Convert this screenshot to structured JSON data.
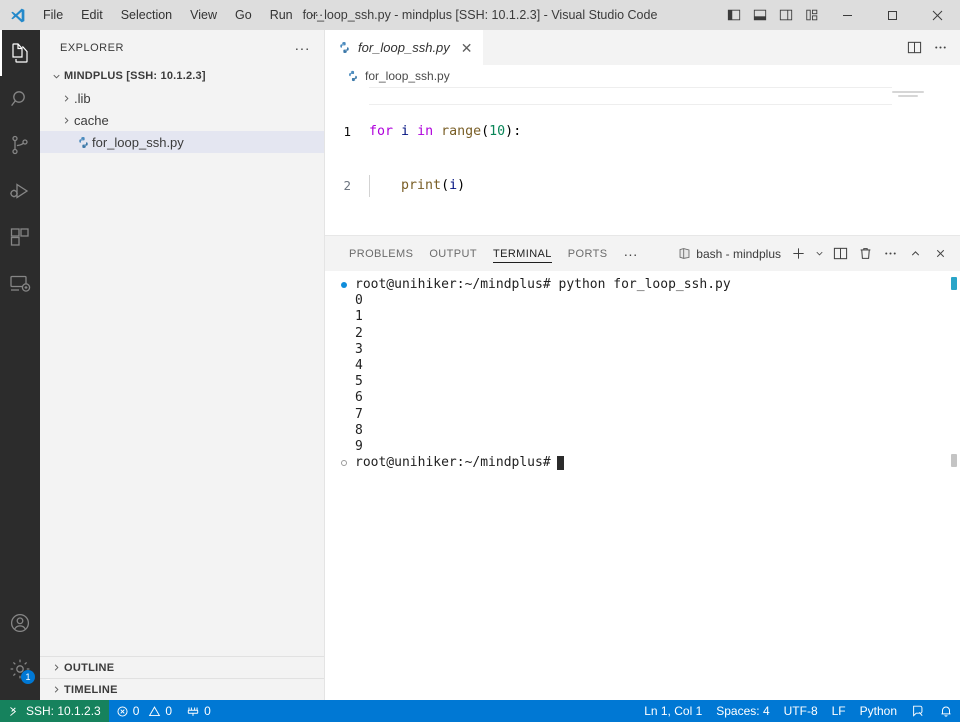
{
  "titlebar": {
    "menus": [
      "File",
      "Edit",
      "Selection",
      "View",
      "Go",
      "Run",
      "···"
    ],
    "window_title": "for_loop_ssh.py - mindplus [SSH: 10.1.2.3] - Visual Studio Code",
    "layout_buttons": [
      "toggle-primary-sidebar",
      "toggle-panel",
      "toggle-secondary-sidebar",
      "customize-layout"
    ],
    "window_controls": {
      "minimize": "─",
      "maximize": "□",
      "close": "✕"
    }
  },
  "activitybar": {
    "items": [
      {
        "name": "explorer",
        "active": true
      },
      {
        "name": "search",
        "active": false
      },
      {
        "name": "source-control",
        "active": false
      },
      {
        "name": "run-and-debug",
        "active": false
      },
      {
        "name": "extensions",
        "active": false
      },
      {
        "name": "remote-explorer",
        "active": false
      }
    ],
    "bottom": [
      {
        "name": "accounts",
        "badge": ""
      },
      {
        "name": "manage-settings",
        "badge": "1"
      }
    ]
  },
  "sidebar": {
    "title": "EXPLORER",
    "more_actions": "···",
    "root": {
      "label": "MINDPLUS [SSH: 10.1.2.3]",
      "expanded": true
    },
    "items": [
      {
        "label": ".lib",
        "type": "folder",
        "expanded": false,
        "selected": false
      },
      {
        "label": "cache",
        "type": "folder",
        "expanded": false,
        "selected": false
      },
      {
        "label": "for_loop_ssh.py",
        "type": "python-file",
        "selected": true
      }
    ],
    "sections": [
      {
        "label": "OUTLINE",
        "expanded": false
      },
      {
        "label": "TIMELINE",
        "expanded": false
      }
    ]
  },
  "editor": {
    "tabs": [
      {
        "label": "for_loop_ssh.py",
        "icon": "python-file-icon",
        "active": true,
        "dirty": false,
        "close": "✕"
      }
    ],
    "tab_actions": [
      "split-editor",
      "more-actions"
    ],
    "breadcrumb": [
      "for_loop_ssh.py"
    ],
    "lines": [
      {
        "number": "1",
        "tokens": [
          {
            "t": "for",
            "c": "k"
          },
          {
            "t": " ",
            "c": "op"
          },
          {
            "t": "i",
            "c": "var"
          },
          {
            "t": " ",
            "c": "op"
          },
          {
            "t": "in",
            "c": "k"
          },
          {
            "t": " ",
            "c": "op"
          },
          {
            "t": "range",
            "c": "fn"
          },
          {
            "t": "(",
            "c": "op"
          },
          {
            "t": "10",
            "c": "num"
          },
          {
            "t": ")",
            "c": "op"
          },
          {
            "t": ":",
            "c": "op"
          }
        ]
      },
      {
        "number": "2",
        "indent": true,
        "tokens": [
          {
            "t": "    ",
            "c": "op"
          },
          {
            "t": "print",
            "c": "fn"
          },
          {
            "t": "(",
            "c": "op"
          },
          {
            "t": "i",
            "c": "var"
          },
          {
            "t": ")",
            "c": "op"
          }
        ]
      }
    ]
  },
  "panel": {
    "tabs": [
      {
        "label": "PROBLEMS",
        "active": false
      },
      {
        "label": "OUTPUT",
        "active": false
      },
      {
        "label": "TERMINAL",
        "active": true
      },
      {
        "label": "PORTS",
        "active": false
      }
    ],
    "more": "···",
    "terminal_name": "bash - mindplus",
    "actions": [
      "new-terminal",
      "terminal-dropdown",
      "split-terminal",
      "kill-terminal",
      "views-and-more",
      "maximize-panel",
      "close-panel"
    ],
    "terminal_lines": [
      {
        "mark": "filled",
        "text": "root@unihiker:~/mindplus# python for_loop_ssh.py"
      },
      {
        "mark": "none",
        "text": "0"
      },
      {
        "mark": "none",
        "text": "1"
      },
      {
        "mark": "none",
        "text": "2"
      },
      {
        "mark": "none",
        "text": "3"
      },
      {
        "mark": "none",
        "text": "4"
      },
      {
        "mark": "none",
        "text": "5"
      },
      {
        "mark": "none",
        "text": "6"
      },
      {
        "mark": "none",
        "text": "7"
      },
      {
        "mark": "none",
        "text": "8"
      },
      {
        "mark": "none",
        "text": "9"
      },
      {
        "mark": "hollow",
        "text": "root@unihiker:~/mindplus#",
        "cursor": true
      }
    ]
  },
  "statusbar": {
    "remote": "SSH: 10.1.2.3",
    "errors": "0",
    "warnings": "0",
    "ports": "0",
    "cursor_position": "Ln 1, Col 1",
    "indentation": "Spaces: 4",
    "encoding": "UTF-8",
    "eol": "LF",
    "language": "Python",
    "feedback": "smiley-icon",
    "notifications": "bell-icon"
  },
  "colors": {
    "accent": "#0078d4",
    "remote_green": "#16825d",
    "titlebar_bg": "#dddddd",
    "sidebar_bg": "#f3f3f3",
    "editor_bg": "#ffffff",
    "activitybar_bg": "#2c2c2c",
    "keyword": "#af00db",
    "function": "#795e26",
    "number": "#098658",
    "variable": "#001080"
  }
}
